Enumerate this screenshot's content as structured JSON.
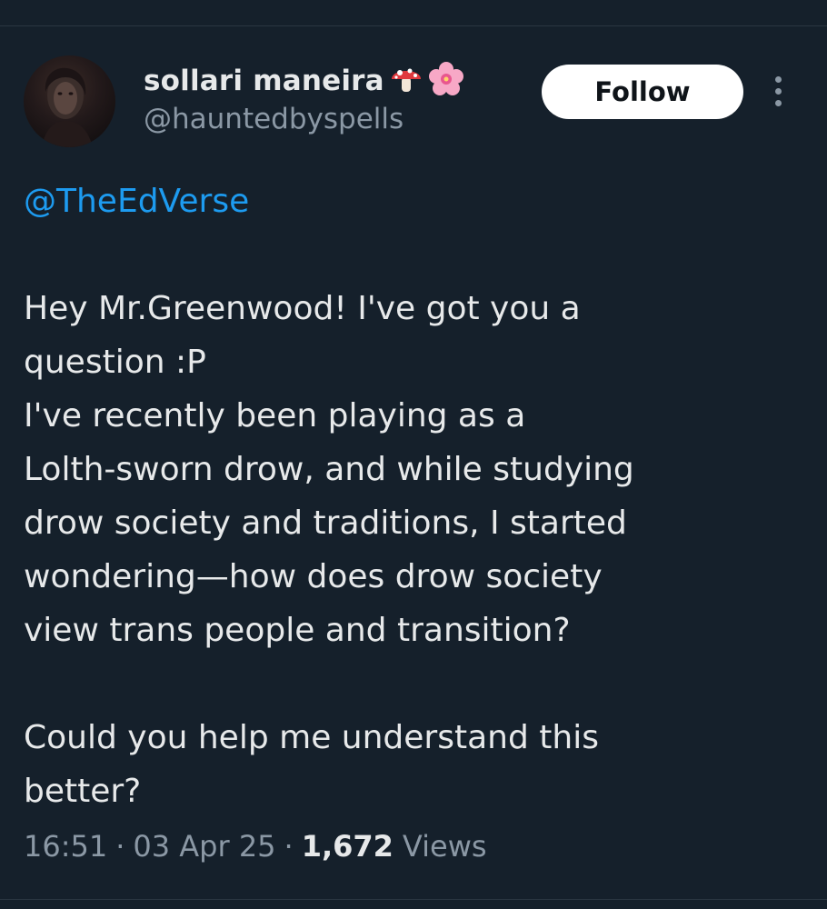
{
  "author": {
    "display_name": "sollari maneira",
    "handle": "@hauntedbyspells",
    "name_emojis": [
      "mushroom-emoji",
      "cherry-blossom-emoji"
    ]
  },
  "actions": {
    "follow_label": "Follow",
    "more_icon": "more-vertical-icon"
  },
  "tweet": {
    "mention": "@TheEdVerse",
    "paragraph_1": "Hey Mr.Greenwood! I've got you a\nquestion :P\nI've recently been playing as a\nLolth-sworn drow, and while studying\ndrow society and traditions, I started\nwondering—how does drow society\nview trans people and transition?",
    "paragraph_2": "Could you help me understand this\nbetter?"
  },
  "meta": {
    "time": "16:51",
    "separator": "·",
    "date": "03 Apr 25",
    "views_count": "1,672",
    "views_label": "Views"
  },
  "colors": {
    "background": "#15202b",
    "text": "#e7e9ea",
    "secondary": "#8b98a5",
    "link": "#1d9bf0",
    "button_bg": "#ffffff"
  }
}
